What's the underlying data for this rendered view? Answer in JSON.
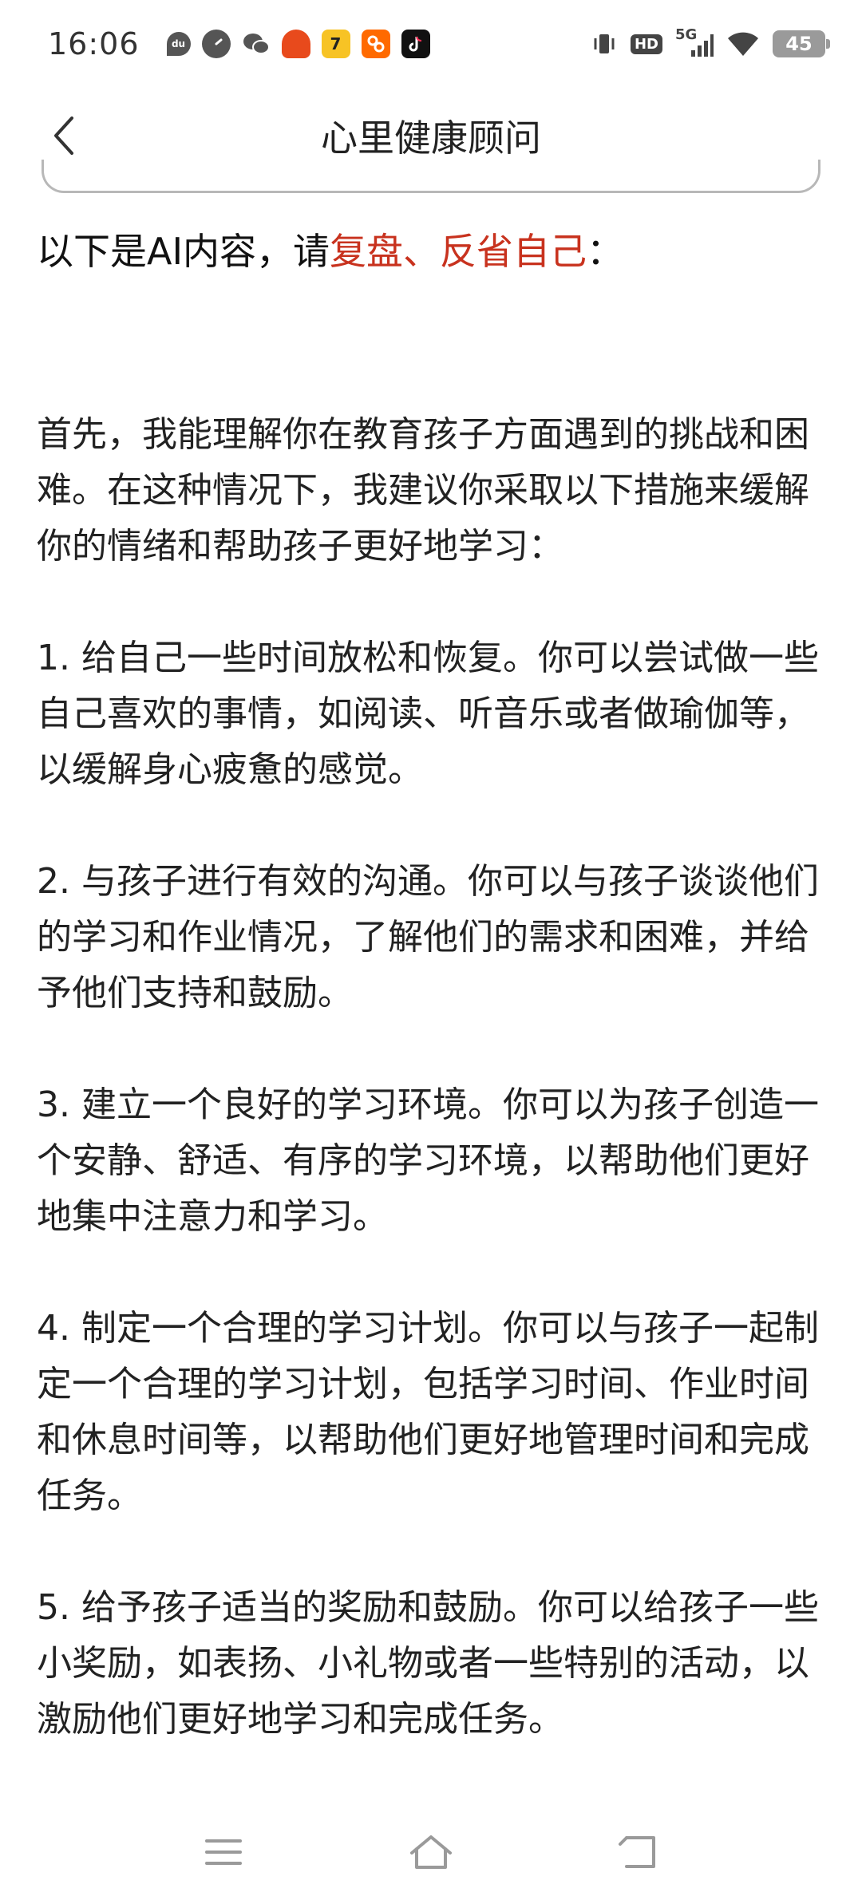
{
  "status_bar": {
    "time": "16:06",
    "battery": "45",
    "network": "5G",
    "hd": "HD",
    "notification_icons": [
      "du-icon",
      "speed-icon",
      "wechat-icon",
      "food-icon",
      "app7-icon",
      "kuaishou-icon",
      "tiktok-icon"
    ]
  },
  "header": {
    "title": "心里健康顾问"
  },
  "content": {
    "intro_prefix": "以下是AI内容，请",
    "intro_accent": "复盘、反省自己",
    "intro_suffix": "：",
    "accent_color": "#c8321e",
    "paragraphs": [
      "首先，我能理解你在教育孩子方面遇到的挑战和困难。在这种情况下，我建议你采取以下措施来缓解你的情绪和帮助孩子更好地学习：",
      "1. 给自己一些时间放松和恢复。你可以尝试做一些自己喜欢的事情，如阅读、听音乐或者做瑜伽等，以缓解身心疲惫的感觉。",
      "2. 与孩子进行有效的沟通。你可以与孩子谈谈他们的学习和作业情况，了解他们的需求和困难，并给予他们支持和鼓励。",
      "3. 建立一个良好的学习环境。你可以为孩子创造一个安静、舒适、有序的学习环境，以帮助他们更好地集中注意力和学习。",
      "4. 制定一个合理的学习计划。你可以与孩子一起制定一个合理的学习计划，包括学习时间、作业时间和休息时间等，以帮助他们更好地管理时间和完成任务。",
      "5. 给予孩子适当的奖励和鼓励。你可以给孩子一些小奖励，如表扬、小礼物或者一些特别的活动，以激励他们更好地学习和完成任务。"
    ]
  },
  "nav_bar": {
    "icons": [
      "menu-icon",
      "home-icon",
      "back-nav-icon"
    ]
  }
}
